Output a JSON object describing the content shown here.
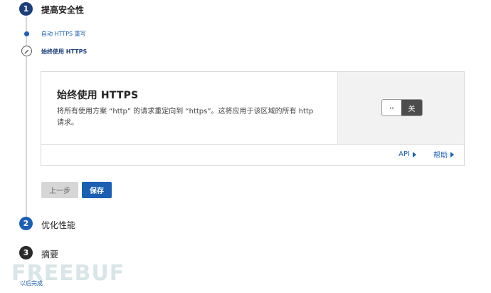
{
  "steps": [
    {
      "num": "1",
      "title": "提高安全性"
    },
    {
      "num": "2",
      "title": "优化性能"
    },
    {
      "num": "3",
      "title": "摘要"
    }
  ],
  "substeps": [
    {
      "label": "自动 HTTPS 重写",
      "icon": "dot-icon",
      "color": "#1b5fb3"
    },
    {
      "label": "始终使用 HTTPS",
      "icon": "pencil-icon",
      "color": "#1b3f7a"
    }
  ],
  "card": {
    "title": "始终使用 HTTPS",
    "description": "将所有使用方案 “http” 的请求重定向到 “https”。这将应用于该区域的所有 http 请求。",
    "toggle_knob": "‹›",
    "toggle_label": "关",
    "footer": {
      "api": "API",
      "help": "帮助"
    }
  },
  "buttons": {
    "back": "上一步",
    "save": "保存"
  },
  "finish_link": "以后完成",
  "watermark": "FREEBUF",
  "colors": {
    "accent": "#1b5fb3",
    "step_active": "#1b3f7a",
    "step_inactive": "#2a2a2a"
  }
}
